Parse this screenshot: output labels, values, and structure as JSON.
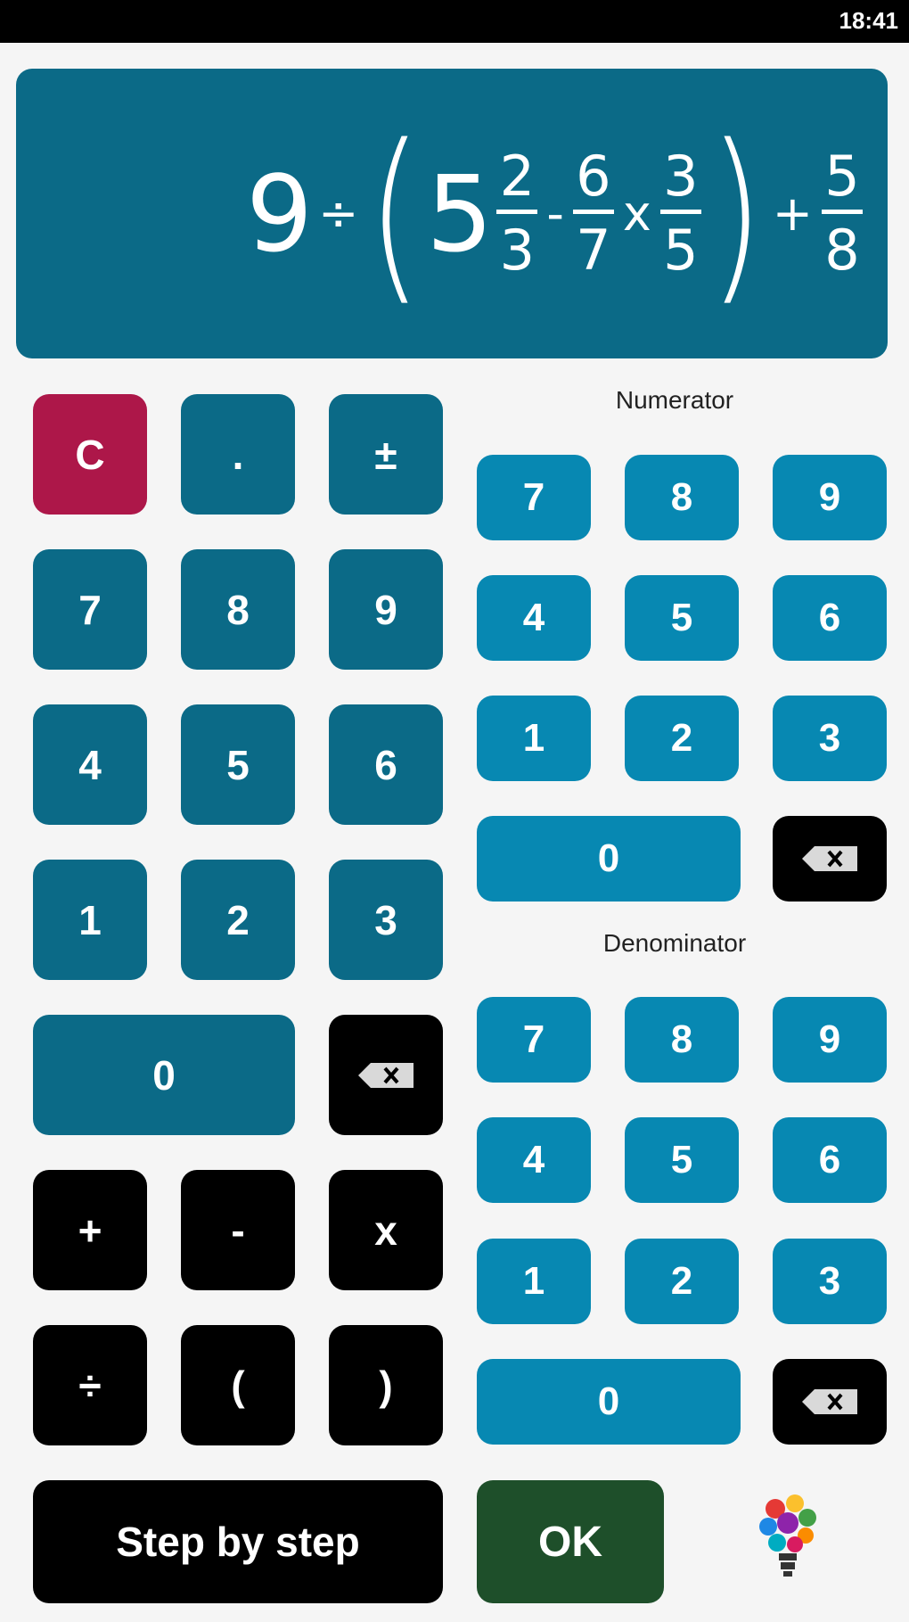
{
  "status_bar": {
    "time": "18:41"
  },
  "display": {
    "whole": "9",
    "op1": "÷",
    "open_paren": "(",
    "mixed_whole": "5",
    "frac1": {
      "num": "2",
      "den": "3"
    },
    "op2": "-",
    "frac2": {
      "num": "6",
      "den": "7"
    },
    "op3": "x",
    "frac3": {
      "num": "3",
      "den": "5"
    },
    "close_paren": ")",
    "op4": "+",
    "frac4": {
      "num": "5",
      "den": "8"
    }
  },
  "left_keypad": {
    "clear": "C",
    "dot": ".",
    "sign": "±",
    "digits": [
      "7",
      "8",
      "9",
      "4",
      "5",
      "6",
      "1",
      "2",
      "3"
    ],
    "zero": "0",
    "plus": "+",
    "minus": "-",
    "multiply": "x",
    "divide": "÷",
    "open_paren": "(",
    "close_paren": ")"
  },
  "numerator_pad": {
    "label": "Numerator",
    "digits": [
      "7",
      "8",
      "9",
      "4",
      "5",
      "6",
      "1",
      "2",
      "3"
    ],
    "zero": "0"
  },
  "denominator_pad": {
    "label": "Denominator",
    "digits": [
      "7",
      "8",
      "9",
      "4",
      "5",
      "6",
      "1",
      "2",
      "3"
    ],
    "zero": "0"
  },
  "actions": {
    "step_by_step": "Step by step",
    "ok": "OK"
  },
  "colors": {
    "display_bg": "#0b6a87",
    "left_key": "#0b6a87",
    "right_key": "#0788b2",
    "clear_key": "#ad1749",
    "ok_key": "#1e4f2a",
    "operator_key": "#000000"
  },
  "icons": {
    "backspace": "backspace-icon",
    "hint": "lightbulb-icon"
  }
}
